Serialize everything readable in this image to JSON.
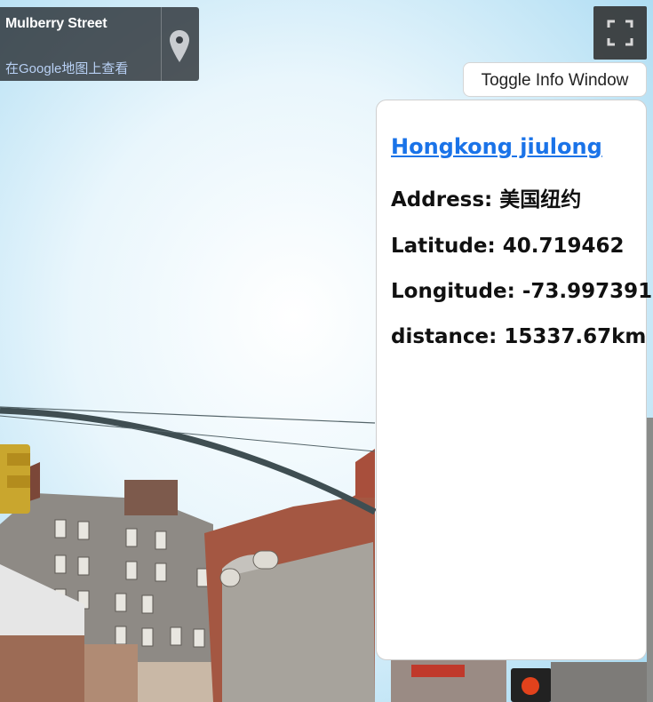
{
  "location_card": {
    "title": "Mulberry Street",
    "link_text": "在Google地图上查看",
    "pin_icon": "map-pin-icon"
  },
  "controls": {
    "fullscreen_icon": "fullscreen-icon",
    "toggle_label": "Toggle Info Window"
  },
  "info": {
    "title": "Hongkong jiulong",
    "address_label": "Address: ",
    "address_value": "美国纽约",
    "latitude_label": "Latitude: ",
    "latitude_value": "40.719462",
    "longitude_label": "Longitude: ",
    "longitude_value": "-73.997391",
    "distance_label": "distance: ",
    "distance_value": "15337.67km"
  },
  "colors": {
    "link_blue": "#1a73e8",
    "card_bg": "#2a2f35"
  }
}
